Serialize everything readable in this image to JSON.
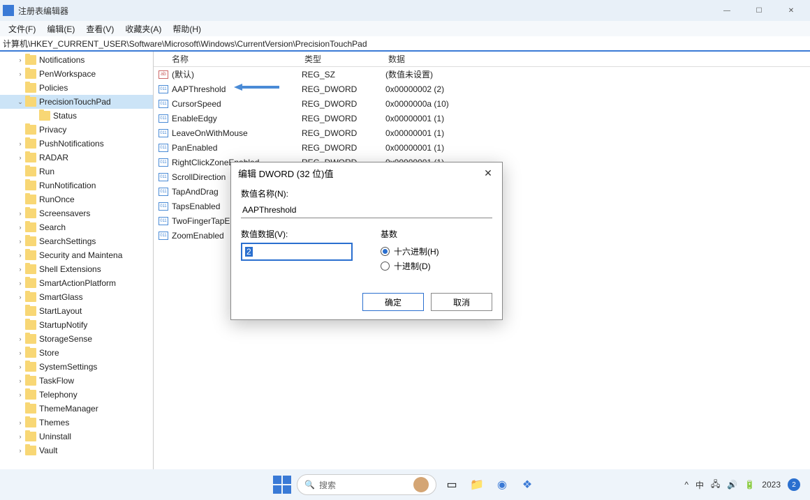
{
  "window": {
    "title": "注册表编辑器",
    "menu": [
      "文件(F)",
      "编辑(E)",
      "查看(V)",
      "收藏夹(A)",
      "帮助(H)"
    ],
    "address": "计算机\\HKEY_CURRENT_USER\\Software\\Microsoft\\Windows\\CurrentVersion\\PrecisionTouchPad",
    "controls": {
      "min": "—",
      "max": "☐",
      "close": "✕"
    }
  },
  "tree": [
    {
      "n": "Notifications",
      "c": ">"
    },
    {
      "n": "PenWorkspace",
      "c": ">"
    },
    {
      "n": "Policies",
      "c": ""
    },
    {
      "n": "PrecisionTouchPad",
      "c": "v",
      "sel": true
    },
    {
      "n": "Status",
      "c": "",
      "child": true
    },
    {
      "n": "Privacy",
      "c": ""
    },
    {
      "n": "PushNotifications",
      "c": ">"
    },
    {
      "n": "RADAR",
      "c": ">"
    },
    {
      "n": "Run",
      "c": ""
    },
    {
      "n": "RunNotification",
      "c": ""
    },
    {
      "n": "RunOnce",
      "c": ""
    },
    {
      "n": "Screensavers",
      "c": ">"
    },
    {
      "n": "Search",
      "c": ">"
    },
    {
      "n": "SearchSettings",
      "c": ">"
    },
    {
      "n": "Security and Maintena",
      "c": ">"
    },
    {
      "n": "Shell Extensions",
      "c": ">"
    },
    {
      "n": "SmartActionPlatform",
      "c": ">"
    },
    {
      "n": "SmartGlass",
      "c": ">"
    },
    {
      "n": "StartLayout",
      "c": ""
    },
    {
      "n": "StartupNotify",
      "c": ""
    },
    {
      "n": "StorageSense",
      "c": ">"
    },
    {
      "n": "Store",
      "c": ">"
    },
    {
      "n": "SystemSettings",
      "c": ">"
    },
    {
      "n": "TaskFlow",
      "c": ">"
    },
    {
      "n": "Telephony",
      "c": ">"
    },
    {
      "n": "ThemeManager",
      "c": ""
    },
    {
      "n": "Themes",
      "c": ">"
    },
    {
      "n": "Uninstall",
      "c": ">"
    },
    {
      "n": "Vault",
      "c": ">"
    }
  ],
  "list": {
    "headers": {
      "name": "名称",
      "type": "类型",
      "data": "数据"
    },
    "rows": [
      {
        "icon": "ab",
        "name": "(默认)",
        "type": "REG_SZ",
        "data": "(数值未设置)"
      },
      {
        "icon": "bin",
        "name": "AAPThreshold",
        "type": "REG_DWORD",
        "data": "0x00000002 (2)"
      },
      {
        "icon": "bin",
        "name": "CursorSpeed",
        "type": "REG_DWORD",
        "data": "0x0000000a (10)"
      },
      {
        "icon": "bin",
        "name": "EnableEdgy",
        "type": "REG_DWORD",
        "data": "0x00000001 (1)"
      },
      {
        "icon": "bin",
        "name": "LeaveOnWithMouse",
        "type": "REG_DWORD",
        "data": "0x00000001 (1)"
      },
      {
        "icon": "bin",
        "name": "PanEnabled",
        "type": "REG_DWORD",
        "data": "0x00000001 (1)"
      },
      {
        "icon": "bin",
        "name": "RightClickZoneEnabled",
        "type": "REG_DWORD",
        "data": "0x00000001 (1)"
      },
      {
        "icon": "bin",
        "name": "ScrollDirection",
        "type": "",
        "data": ""
      },
      {
        "icon": "bin",
        "name": "TapAndDrag",
        "type": "",
        "data": ""
      },
      {
        "icon": "bin",
        "name": "TapsEnabled",
        "type": "",
        "data": ""
      },
      {
        "icon": "bin",
        "name": "TwoFingerTapE",
        "type": "",
        "data": ""
      },
      {
        "icon": "bin",
        "name": "ZoomEnabled",
        "type": "",
        "data": ""
      }
    ]
  },
  "dialog": {
    "title": "编辑 DWORD (32 位)值",
    "name_label": "数值名称(N):",
    "name_value": "AAPThreshold",
    "data_label": "数值数据(V):",
    "data_value": "2",
    "base_label": "基数",
    "radio_hex": "十六进制(H)",
    "radio_dec": "十进制(D)",
    "ok": "确定",
    "cancel": "取消"
  },
  "taskbar": {
    "search_placeholder": "搜索",
    "ime": "中",
    "year": "2023",
    "badge": "2"
  }
}
